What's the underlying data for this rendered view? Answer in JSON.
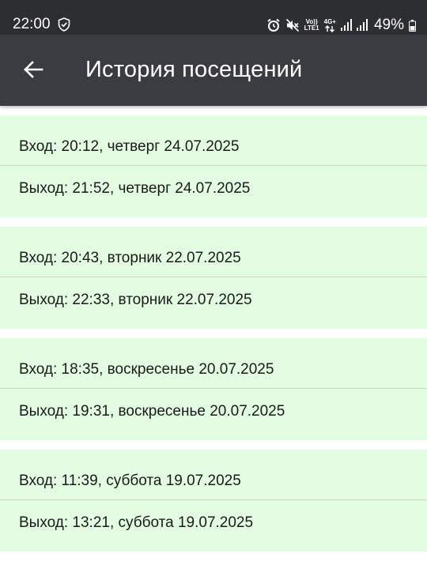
{
  "status_bar": {
    "time": "22:00",
    "network": "4G+",
    "volte_top": "Vo))",
    "volte_bottom": "LTE1",
    "battery": "49%"
  },
  "app_bar": {
    "title": "История посещений",
    "back_icon": "arrow-left-icon"
  },
  "colors": {
    "status_bar_bg": "#2d2e32",
    "app_bar_bg": "#3b3c42",
    "card_bg": "#e3fde3"
  },
  "visits": [
    {
      "entry": "Вход: 20:12, четверг 24.07.2025",
      "exit": "Выход: 21:52, четверг 24.07.2025"
    },
    {
      "entry": "Вход: 20:43, вторник 22.07.2025",
      "exit": "Выход: 22:33, вторник 22.07.2025"
    },
    {
      "entry": "Вход: 18:35, воскресенье 20.07.2025",
      "exit": "Выход: 19:31, воскресенье 20.07.2025"
    },
    {
      "entry": "Вход: 11:39, суббота 19.07.2025",
      "exit": "Выход: 13:21, суббота 19.07.2025"
    }
  ]
}
